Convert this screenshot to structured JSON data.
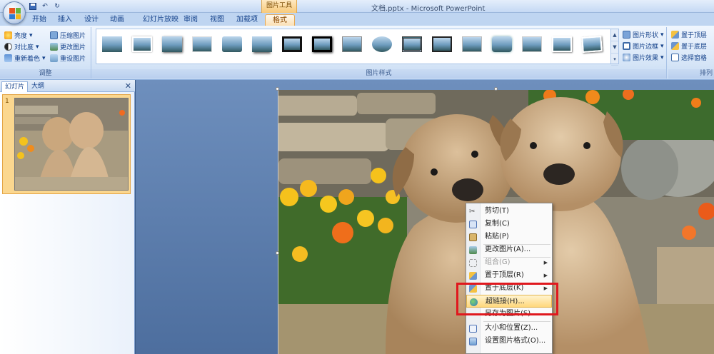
{
  "window": {
    "title": "文档.pptx - Microsoft PowerPoint",
    "context_tool": "图片工具"
  },
  "quick_access": [
    "save-icon",
    "undo-icon",
    "redo-icon"
  ],
  "tabs": [
    {
      "label": "开始"
    },
    {
      "label": "插入"
    },
    {
      "label": "设计"
    },
    {
      "label": "动画"
    },
    {
      "label": "幻灯片放映"
    },
    {
      "label": "审阅"
    },
    {
      "label": "视图"
    },
    {
      "label": "加载项"
    },
    {
      "label": "格式",
      "active": true
    }
  ],
  "ribbon": {
    "adjust": {
      "label": "调整",
      "brightness": "亮度",
      "contrast": "对比度",
      "recolor": "重新着色",
      "compress": "压缩图片",
      "change": "更改图片",
      "reset": "重设图片"
    },
    "styles": {
      "label": "图片样式",
      "shape": "图片形状",
      "border": "图片边框",
      "effects": "图片效果"
    },
    "arrange": {
      "label": "排列",
      "front": "置于顶层",
      "back": "置于底层",
      "pane": "选择窗格"
    }
  },
  "pane": {
    "tab_slides": "幻灯片",
    "tab_outline": "大纲",
    "slide_number": "1"
  },
  "menu": [
    {
      "label": "剪切(T)",
      "icon": "cut-icon"
    },
    {
      "label": "复制(C)",
      "icon": "copy-icon"
    },
    {
      "label": "粘贴(P)",
      "icon": "paste-icon"
    },
    {
      "label": "更改图片(A)...",
      "icon": "change-picture-icon"
    },
    {
      "label": "组合(G)",
      "icon": "group-icon",
      "disabled": true
    },
    {
      "label": "置于顶层(R)",
      "icon": "bring-front-icon"
    },
    {
      "label": "置于底层(K)",
      "icon": "send-back-icon"
    },
    {
      "label": "超链接(H)...",
      "icon": "hyperlink-icon",
      "highlighted": true
    },
    {
      "label": "另存为图片(S)...",
      "icon": ""
    },
    {
      "label": "大小和位置(Z)...",
      "icon": "size-position-icon"
    },
    {
      "label": "设置图片格式(O)...",
      "icon": "format-picture-icon"
    }
  ],
  "colors": {
    "ribbon": "#d6e5f7",
    "context_tab": "#f7c97a",
    "annotation": "#e0181e"
  }
}
